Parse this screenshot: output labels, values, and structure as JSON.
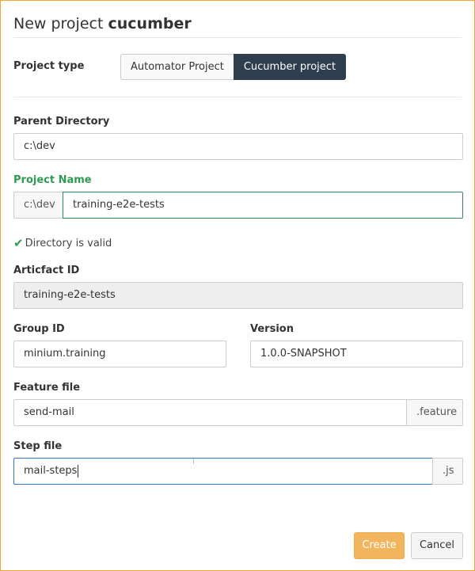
{
  "dialog": {
    "title_prefix": "New project",
    "title_name": "cucumber"
  },
  "project_type": {
    "label": "Project type",
    "options": [
      "Automator Project",
      "Cucumber project"
    ],
    "selected": "Cucumber project"
  },
  "parent_directory": {
    "label": "Parent Directory",
    "value": "c:\\dev"
  },
  "project_name": {
    "label": "Project Name",
    "prefix": "c:\\dev",
    "value": "training-e2e-tests",
    "validation": "Directory is valid"
  },
  "artifact_id": {
    "label": "Articfact ID",
    "value": "training-e2e-tests"
  },
  "group_id": {
    "label": "Group ID",
    "value": "minium.training"
  },
  "version": {
    "label": "Version",
    "value": "1.0.0-SNAPSHOT"
  },
  "feature_file": {
    "label": "Feature file",
    "value": "send-mail",
    "suffix": ".feature"
  },
  "step_file": {
    "label": "Step file",
    "value": "mail-steps",
    "suffix": ".js"
  },
  "actions": {
    "create": "Create",
    "cancel": "Cancel"
  },
  "colors": {
    "dialog_border": "#f0a830",
    "selected_segment": "#2f3e4e",
    "valid_green": "#2e9a52",
    "create_button": "#f2b55e"
  }
}
